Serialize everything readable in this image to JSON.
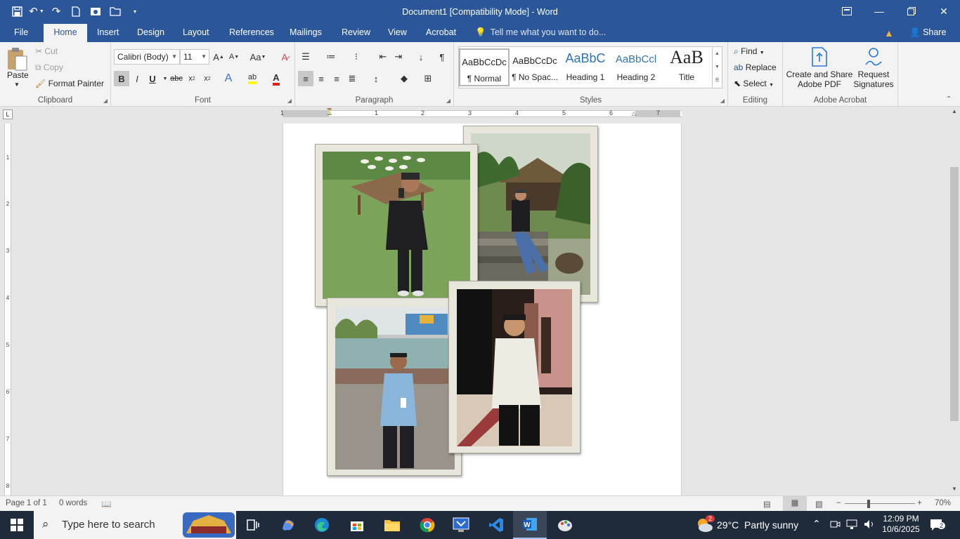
{
  "window": {
    "title": "Document1 [Compatibility Mode] - Word"
  },
  "tabs": [
    {
      "label": "File"
    },
    {
      "label": "Home"
    },
    {
      "label": "Insert"
    },
    {
      "label": "Design"
    },
    {
      "label": "Layout"
    },
    {
      "label": "References"
    },
    {
      "label": "Mailings"
    },
    {
      "label": "Review"
    },
    {
      "label": "View"
    },
    {
      "label": "Acrobat"
    }
  ],
  "tell_me": "Tell me what you want to do...",
  "share": "Share",
  "clipboard": {
    "paste": "Paste",
    "cut": "Cut",
    "copy": "Copy",
    "format_painter": "Format Painter",
    "label": "Clipboard"
  },
  "font": {
    "name": "Calibri (Body)",
    "size": "11",
    "label": "Font"
  },
  "paragraph": {
    "label": "Paragraph"
  },
  "styles": {
    "label": "Styles",
    "items": [
      {
        "sample": "AaBbCcDc",
        "name": "¶ Normal",
        "color": "#262626"
      },
      {
        "sample": "AaBbCcDc",
        "name": "¶ No Spac...",
        "color": "#262626"
      },
      {
        "sample": "AaBbC",
        "name": "Heading 1",
        "color": "#2e74b5"
      },
      {
        "sample": "AaBbCcl",
        "name": "Heading 2",
        "color": "#2e74b5"
      },
      {
        "sample": "AaB",
        "name": "Title",
        "color": "#000000"
      }
    ]
  },
  "editing": {
    "find": "Find",
    "replace": "Replace",
    "select": "Select",
    "label": "Editing"
  },
  "acrobat": {
    "create_share": "Create and Share",
    "create_share_2": "Adobe PDF",
    "request": "Request",
    "request_2": "Signatures",
    "label": "Adobe Acrobat"
  },
  "ruler": {
    "h_numbers": [
      "1",
      "1",
      "2",
      "3",
      "4",
      "5",
      "6",
      "7"
    ],
    "v_numbers": [
      "1",
      "2",
      "3",
      "4",
      "5",
      "6",
      "7",
      "8"
    ]
  },
  "status": {
    "page": "Page 1 of 1",
    "words": "0 words",
    "zoom": "70%"
  },
  "taskbar": {
    "search_placeholder": "Type here to search",
    "weather_badge": "2",
    "weather": "29°C  Partly sunny",
    "time": "12:09 PM",
    "date": "10/6/2025",
    "notifications": "2"
  },
  "colors": {
    "word_blue": "#2b579a",
    "ribbon_bg": "#f3f3f3",
    "doc_bg": "#e6e6e6"
  }
}
